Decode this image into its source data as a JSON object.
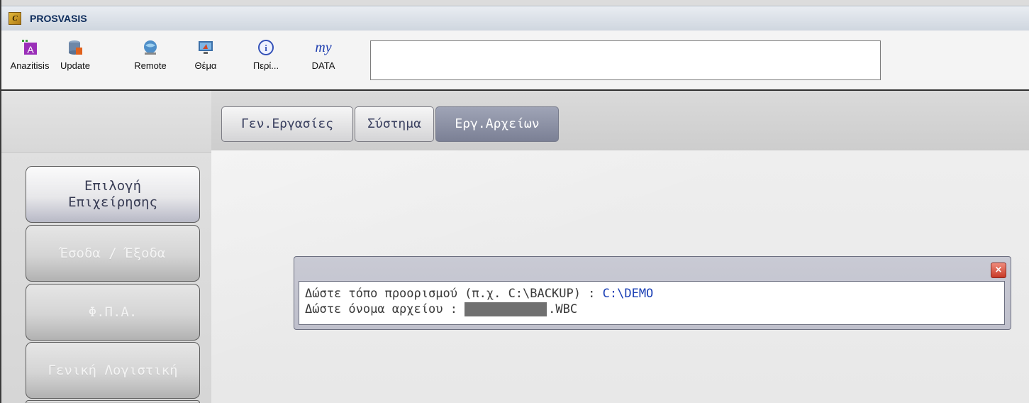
{
  "window": {
    "title": "PROSVASIS",
    "icon": "app-logo-icon",
    "icon_glyph": "C"
  },
  "toolbar": {
    "buttons": [
      {
        "label": "Anazitisis",
        "icon": "search-a-icon"
      },
      {
        "label": "Update",
        "icon": "database-update-icon"
      },
      {
        "label": "Remote",
        "icon": "remote-globe-icon"
      },
      {
        "label": "Θέμα",
        "icon": "theme-monitor-icon"
      },
      {
        "label": "Περί...",
        "icon": "info-icon"
      },
      {
        "label": "DATA",
        "icon": "my-data-icon",
        "icon_text": "my"
      }
    ],
    "input_value": ""
  },
  "tabs": [
    {
      "label": "Γεν.Εργασίες",
      "active": false
    },
    {
      "label": "Σύστημα",
      "active": false
    },
    {
      "label": "Εργ.Αρχείων",
      "active": true
    }
  ],
  "sidebar": {
    "items": [
      {
        "label": "Επιλογή\nΕπιχείρησης",
        "enabled": true
      },
      {
        "label": "Έσοδα / Έξοδα",
        "enabled": false
      },
      {
        "label": "Φ.Π.Α.",
        "enabled": false
      },
      {
        "label": "Γενική Λογιστική",
        "enabled": false
      }
    ]
  },
  "dialog": {
    "close_glyph": "×",
    "line1_prompt": "Δώστε τόπο προορισμού (π.χ. C:\\BACKUP) : ",
    "line1_value": "C:\\DEMO",
    "line2_prompt": "Δώστε όνομα αρχείου : ",
    "line2_value": "",
    "line2_ext": ".WBC"
  },
  "colors": {
    "tab_active_bg": "#7b8095",
    "dialog_value": "#1a3fb5",
    "title_text": "#0b2a5a"
  }
}
